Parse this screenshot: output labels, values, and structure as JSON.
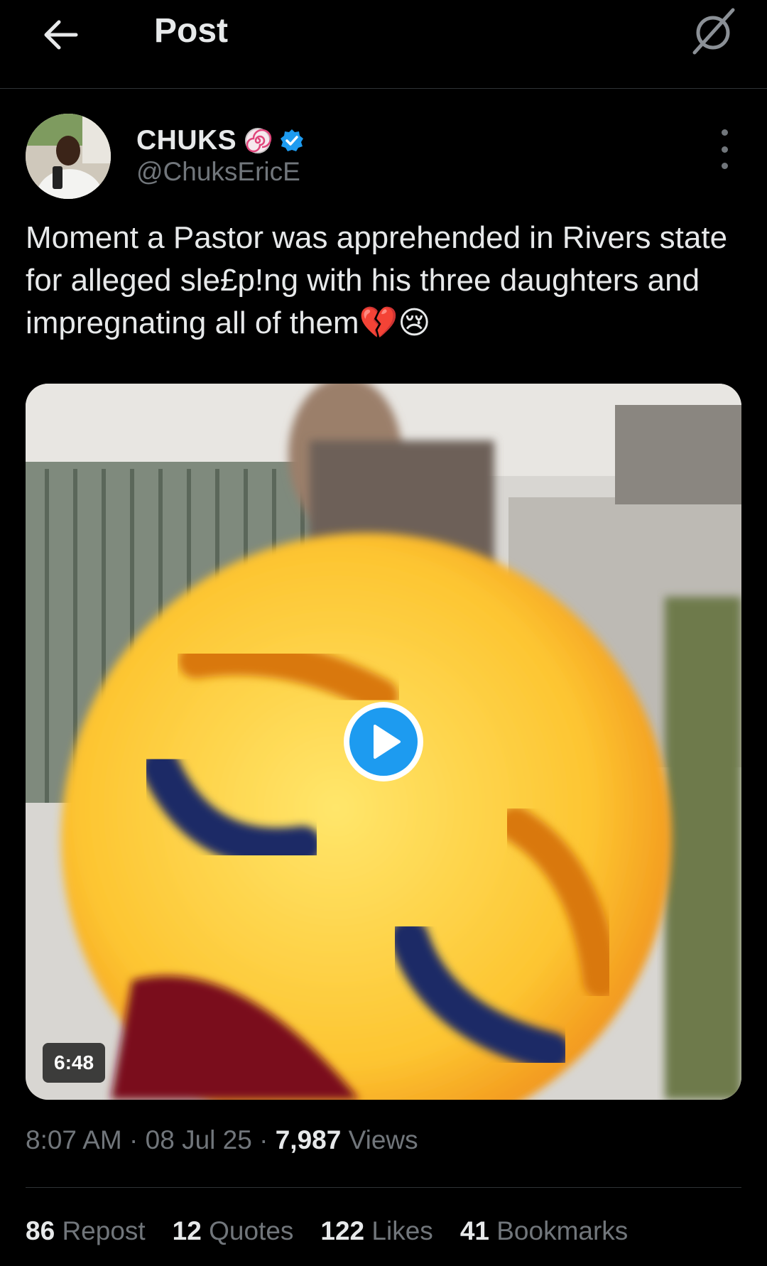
{
  "header": {
    "title": "Post"
  },
  "author": {
    "display_name": "CHUKS",
    "handle": "@ChuksEricE"
  },
  "post": {
    "text": "Moment a Pastor was apprehended in Rivers state for alleged sle£p!ng with his three daughters and impregnating all of them💔😢",
    "media": {
      "duration": "6:48"
    },
    "meta": {
      "time": "8:07 AM",
      "sep1": " · ",
      "date": "08 Jul 25",
      "sep2": " · ",
      "views_count": "7,987",
      "views_label": "Views"
    },
    "stats": [
      {
        "count": "86",
        "label": "Repost"
      },
      {
        "count": "12",
        "label": "Quotes"
      },
      {
        "count": "122",
        "label": "Likes"
      },
      {
        "count": "41",
        "label": "Bookmarks"
      }
    ]
  },
  "colors": {
    "background": "#000000",
    "text": "#e7e9ea",
    "secondary": "#71767b",
    "verified": "#1d9bf0",
    "divider": "#2f3336"
  }
}
